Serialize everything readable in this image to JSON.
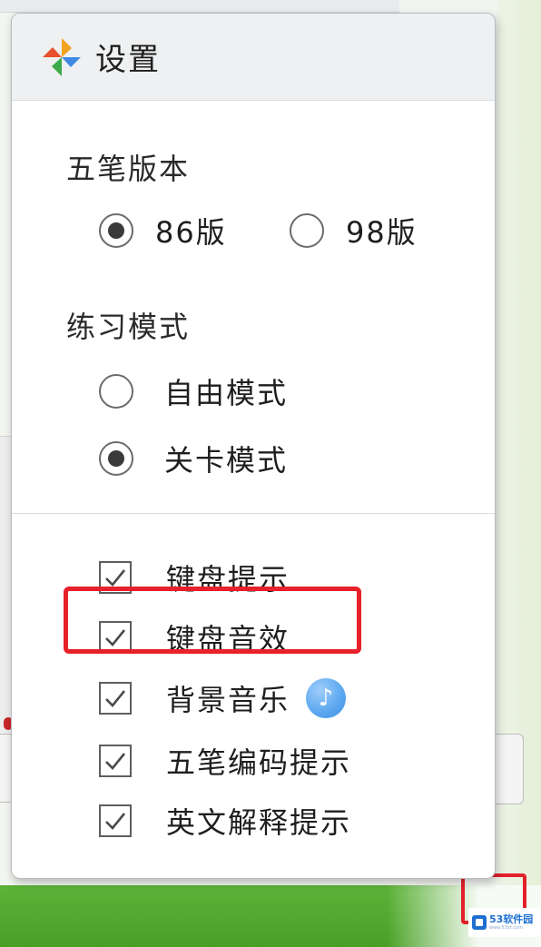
{
  "panel": {
    "title": "设置",
    "logo_icon": "pinwheel-logo-icon"
  },
  "wubi_version": {
    "heading": "五笔版本",
    "options": [
      {
        "label": "86版",
        "checked": true
      },
      {
        "label": "98版",
        "checked": false
      }
    ]
  },
  "practice_mode": {
    "heading": "练习模式",
    "options": [
      {
        "label": "自由模式",
        "checked": false
      },
      {
        "label": "关卡模式",
        "checked": true
      }
    ]
  },
  "toggles": [
    {
      "label": "键盘提示",
      "checked": true
    },
    {
      "label": "键盘音效",
      "checked": true
    },
    {
      "label": "背景音乐",
      "checked": true,
      "icon": "music-note-icon"
    },
    {
      "label": "五笔编码提示",
      "checked": true
    },
    {
      "label": "英文解释提示",
      "checked": true
    }
  ],
  "watermark": {
    "text": "53软件园",
    "sub": "www.53xt.com"
  },
  "colors": {
    "highlight": "#e8202a",
    "bottom_bar": "#4fa82e",
    "music_icon": "#5aa6ef"
  }
}
